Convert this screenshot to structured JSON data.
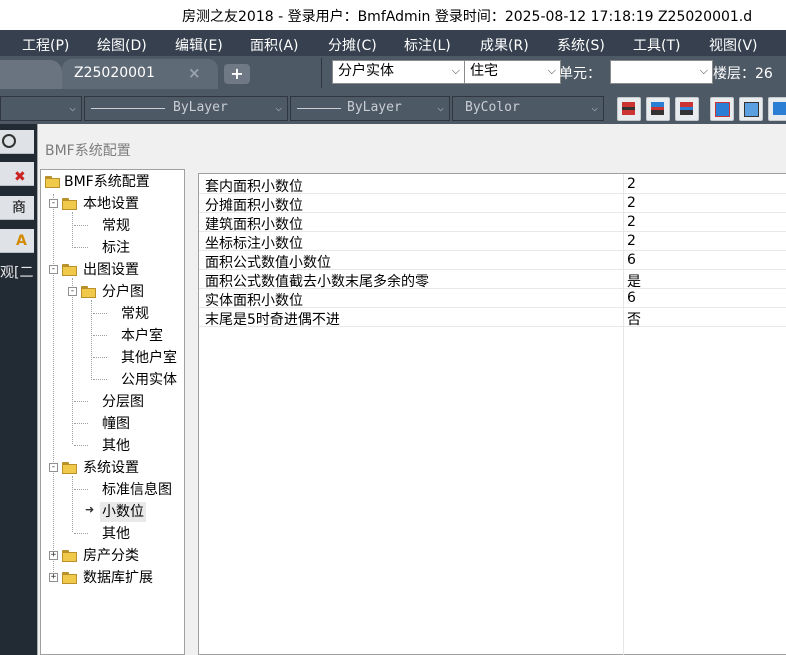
{
  "window": {
    "title": "房测之友2018 - 登录用户：BmfAdmin  登录时间：2025-08-12 17:18:19    Z25020001.d"
  },
  "menu": {
    "items": [
      {
        "label": "工程(P)"
      },
      {
        "label": "绘图(D)"
      },
      {
        "label": "编辑(E)"
      },
      {
        "label": "面积(A)"
      },
      {
        "label": "分摊(C)"
      },
      {
        "label": "标注(L)"
      },
      {
        "label": "成果(R)"
      },
      {
        "label": "系统(S)"
      },
      {
        "label": "工具(T)"
      },
      {
        "label": "视图(V)"
      }
    ]
  },
  "tabs": {
    "active": {
      "label": "Z25020001",
      "close": "×"
    },
    "add": "+"
  },
  "selectors": {
    "entity": {
      "value": "分户实体"
    },
    "usage": {
      "value": "住宅"
    },
    "unit_label": "单元：",
    "unit_value": "",
    "floor_label": "楼层：26"
  },
  "properties": {
    "linetype1": "ByLayer",
    "linetype2": "ByLayer",
    "color": "ByColor"
  },
  "leftstrip": {
    "shang": "商",
    "text": "观[二"
  },
  "dialog": {
    "title": "BMF系统配置",
    "tree": {
      "root": "BMF系统配置",
      "local": "本地设置",
      "local_general": "常规",
      "local_label": "标注",
      "output": "出图设置",
      "household": "分户图",
      "hh_general": "常规",
      "hh_room": "本户室",
      "hh_other_room": "其他户室",
      "hh_public": "公用实体",
      "layer": "分层图",
      "building": "幢图",
      "output_other": "其他",
      "system": "系统设置",
      "sys_standard": "标准信息图",
      "sys_decimal": "小数位",
      "sys_other": "其他",
      "house_cat": "房产分类",
      "db_ext": "数据库扩展"
    },
    "grid": {
      "rows": [
        {
          "key": "套内面积小数位",
          "value": "2"
        },
        {
          "key": "分摊面积小数位",
          "value": "2"
        },
        {
          "key": "建筑面积小数位",
          "value": "2"
        },
        {
          "key": "坐标标注小数位",
          "value": "2"
        },
        {
          "key": "面积公式数值小数位",
          "value": "6"
        },
        {
          "key": "面积公式数值截去小数末尾多余的零",
          "value": "是"
        },
        {
          "key": "实体面积小数位",
          "value": "6"
        },
        {
          "key": "末尾是5时奇进偶不进",
          "value": "否"
        }
      ]
    }
  }
}
